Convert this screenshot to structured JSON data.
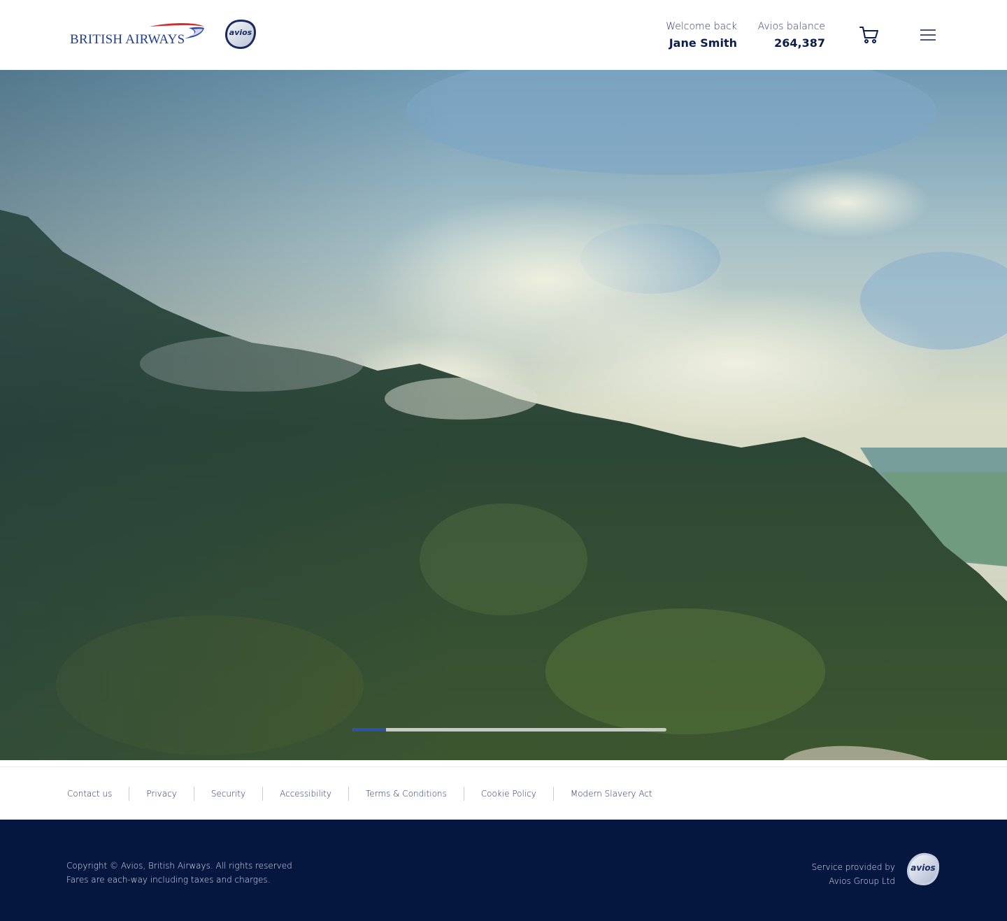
{
  "header": {
    "brand": "BRITISH AIRWAYS",
    "avios_logo": "avios",
    "welcome_label": "Welcome back",
    "user_name": "Jane Smith",
    "balance_label": "Avios balance",
    "balance_value": "264,387",
    "cart_icon": "cart-icon",
    "menu_icon": "hamburger-menu-icon"
  },
  "hero": {
    "image": "forested-mountain-with-clouds",
    "progress": 0.107,
    "progress_color": "#2b55a3"
  },
  "footer": {
    "links": [
      "Contact us",
      "Privacy",
      "Security",
      "Accessibility",
      "Terms & Conditions",
      "Cookie Policy",
      "Modern Slavery Act"
    ],
    "copyright": "Copyright © Avios, British Airways. All rights reserved",
    "fares_note": "Fares are each-way including taxes and charges.",
    "service_line1": "Service provided by",
    "service_line2": "Avios Group Ltd",
    "avios_logo": "avios"
  },
  "colors": {
    "brand_blue": "#1f3f8f",
    "brand_red": "#d42b2b",
    "footer_navy": "#05163f"
  }
}
